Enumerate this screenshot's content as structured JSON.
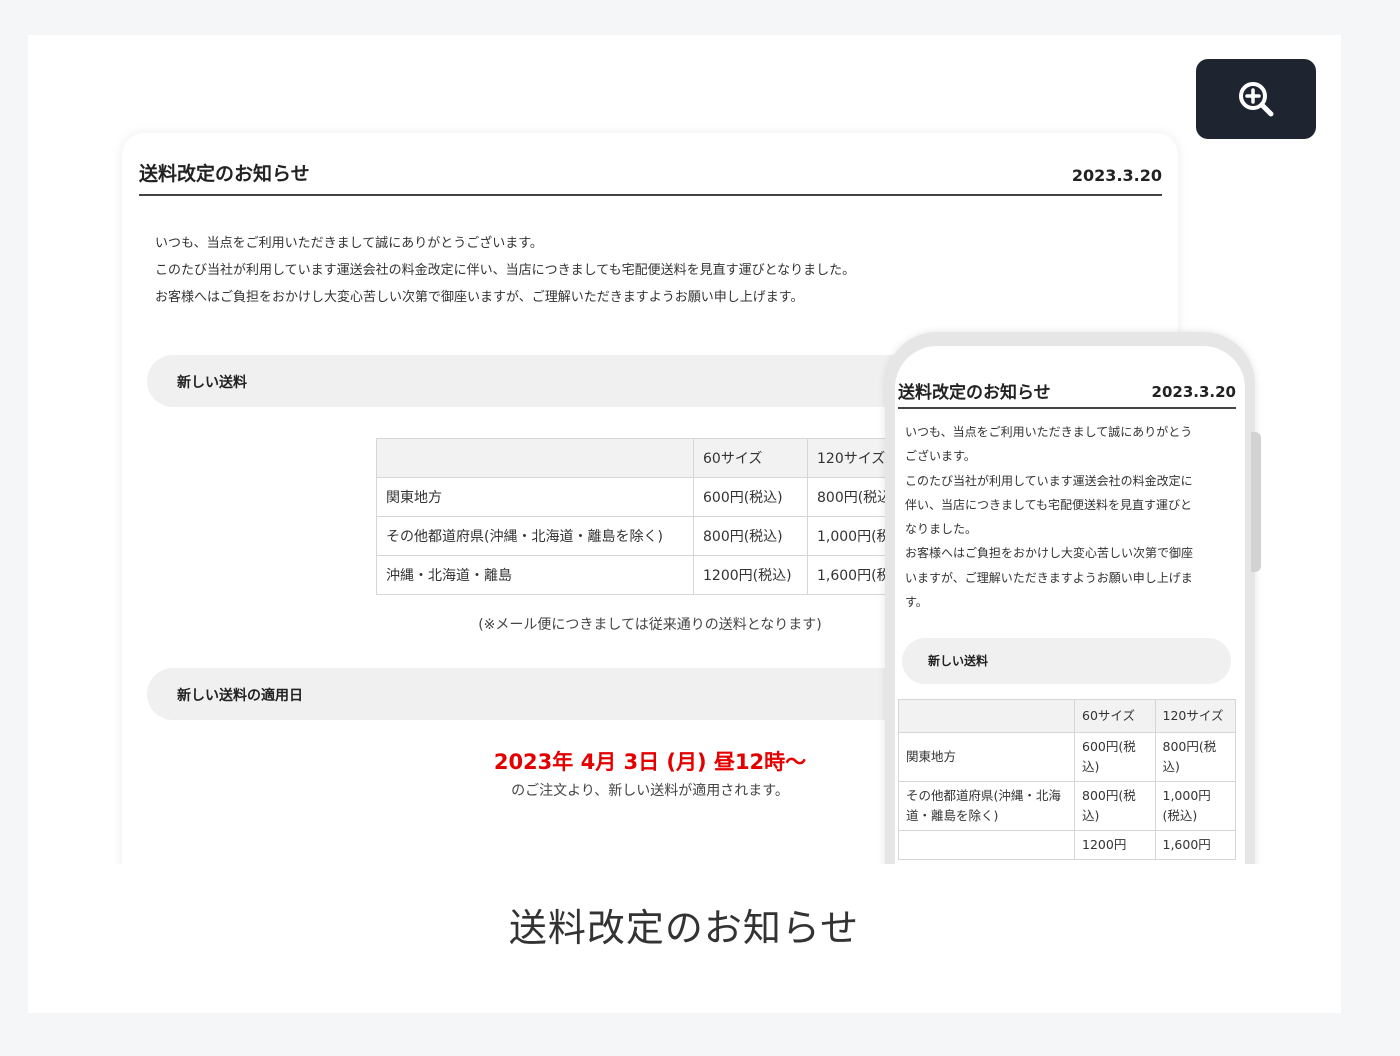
{
  "zoom_button": {
    "icon": "zoom-in-icon",
    "bg_color": "#1f2530"
  },
  "notice": {
    "title": "送料改定のお知らせ",
    "date": "2023.3.20",
    "intro": [
      "いつも、当点をご利用いただきまして誠にありがとうございます。",
      "このたび当社が利用しています運送会社の料金改定に伴い、当店につきましても宅配便送料を見直す運びとなりました。",
      "お客様へはご負担をおかけし大変心苦しい次第で御座いますが、ご理解いただきますようお願い申し上げます。"
    ],
    "section1_label": "新しい送料",
    "table": {
      "headers": [
        "",
        "60サイズ",
        "120サイズ"
      ],
      "rows": [
        [
          "関東地方",
          "600円(税込)",
          "800円(税込)"
        ],
        [
          "その他都道府県(沖縄・北海道・離島を除く)",
          "800円(税込)",
          "1,000円(税込)"
        ],
        [
          "沖縄・北海道・離島",
          "1200円(税込)",
          "1,600円(税込)"
        ]
      ]
    },
    "table_note": "(※メール便につきましては従来通りの送料となります)",
    "section2_label": "新しい送料の適用日",
    "effective_date": "2023年 4月 3日 (月) 昼12時〜",
    "effective_note": "のご注文より、新しい送料が適用されます。",
    "accent_color": "#e50000"
  },
  "mobile": {
    "title": "送料改定のお知らせ",
    "date": "2023.3.20",
    "intro_lines": [
      "いつも、当点をご利用いただきまして誠にありがとう",
      "ございます。",
      "このたび当社が利用しています運送会社の料金改定に",
      "伴い、当店につきましても宅配便送料を見直す運びと",
      "なりました。",
      "お客様へはご負担をおかけし大変心苦しい次第で御座",
      "いますが、ご理解いただきますようお願い申し上げま",
      "す。"
    ],
    "section_label": "新しい送料",
    "table": {
      "headers": [
        "",
        "60サイズ",
        "120サイズ"
      ],
      "rows": [
        [
          "関東地方",
          "600円(税込)",
          "800円(税込)"
        ],
        [
          "その他都道府県(沖縄・北海道・離島を除く)",
          "800円(税込)",
          "1,000円(税込)"
        ],
        [
          "",
          "1200円",
          "1,600円"
        ]
      ]
    }
  },
  "caption": "送料改定のお知らせ"
}
